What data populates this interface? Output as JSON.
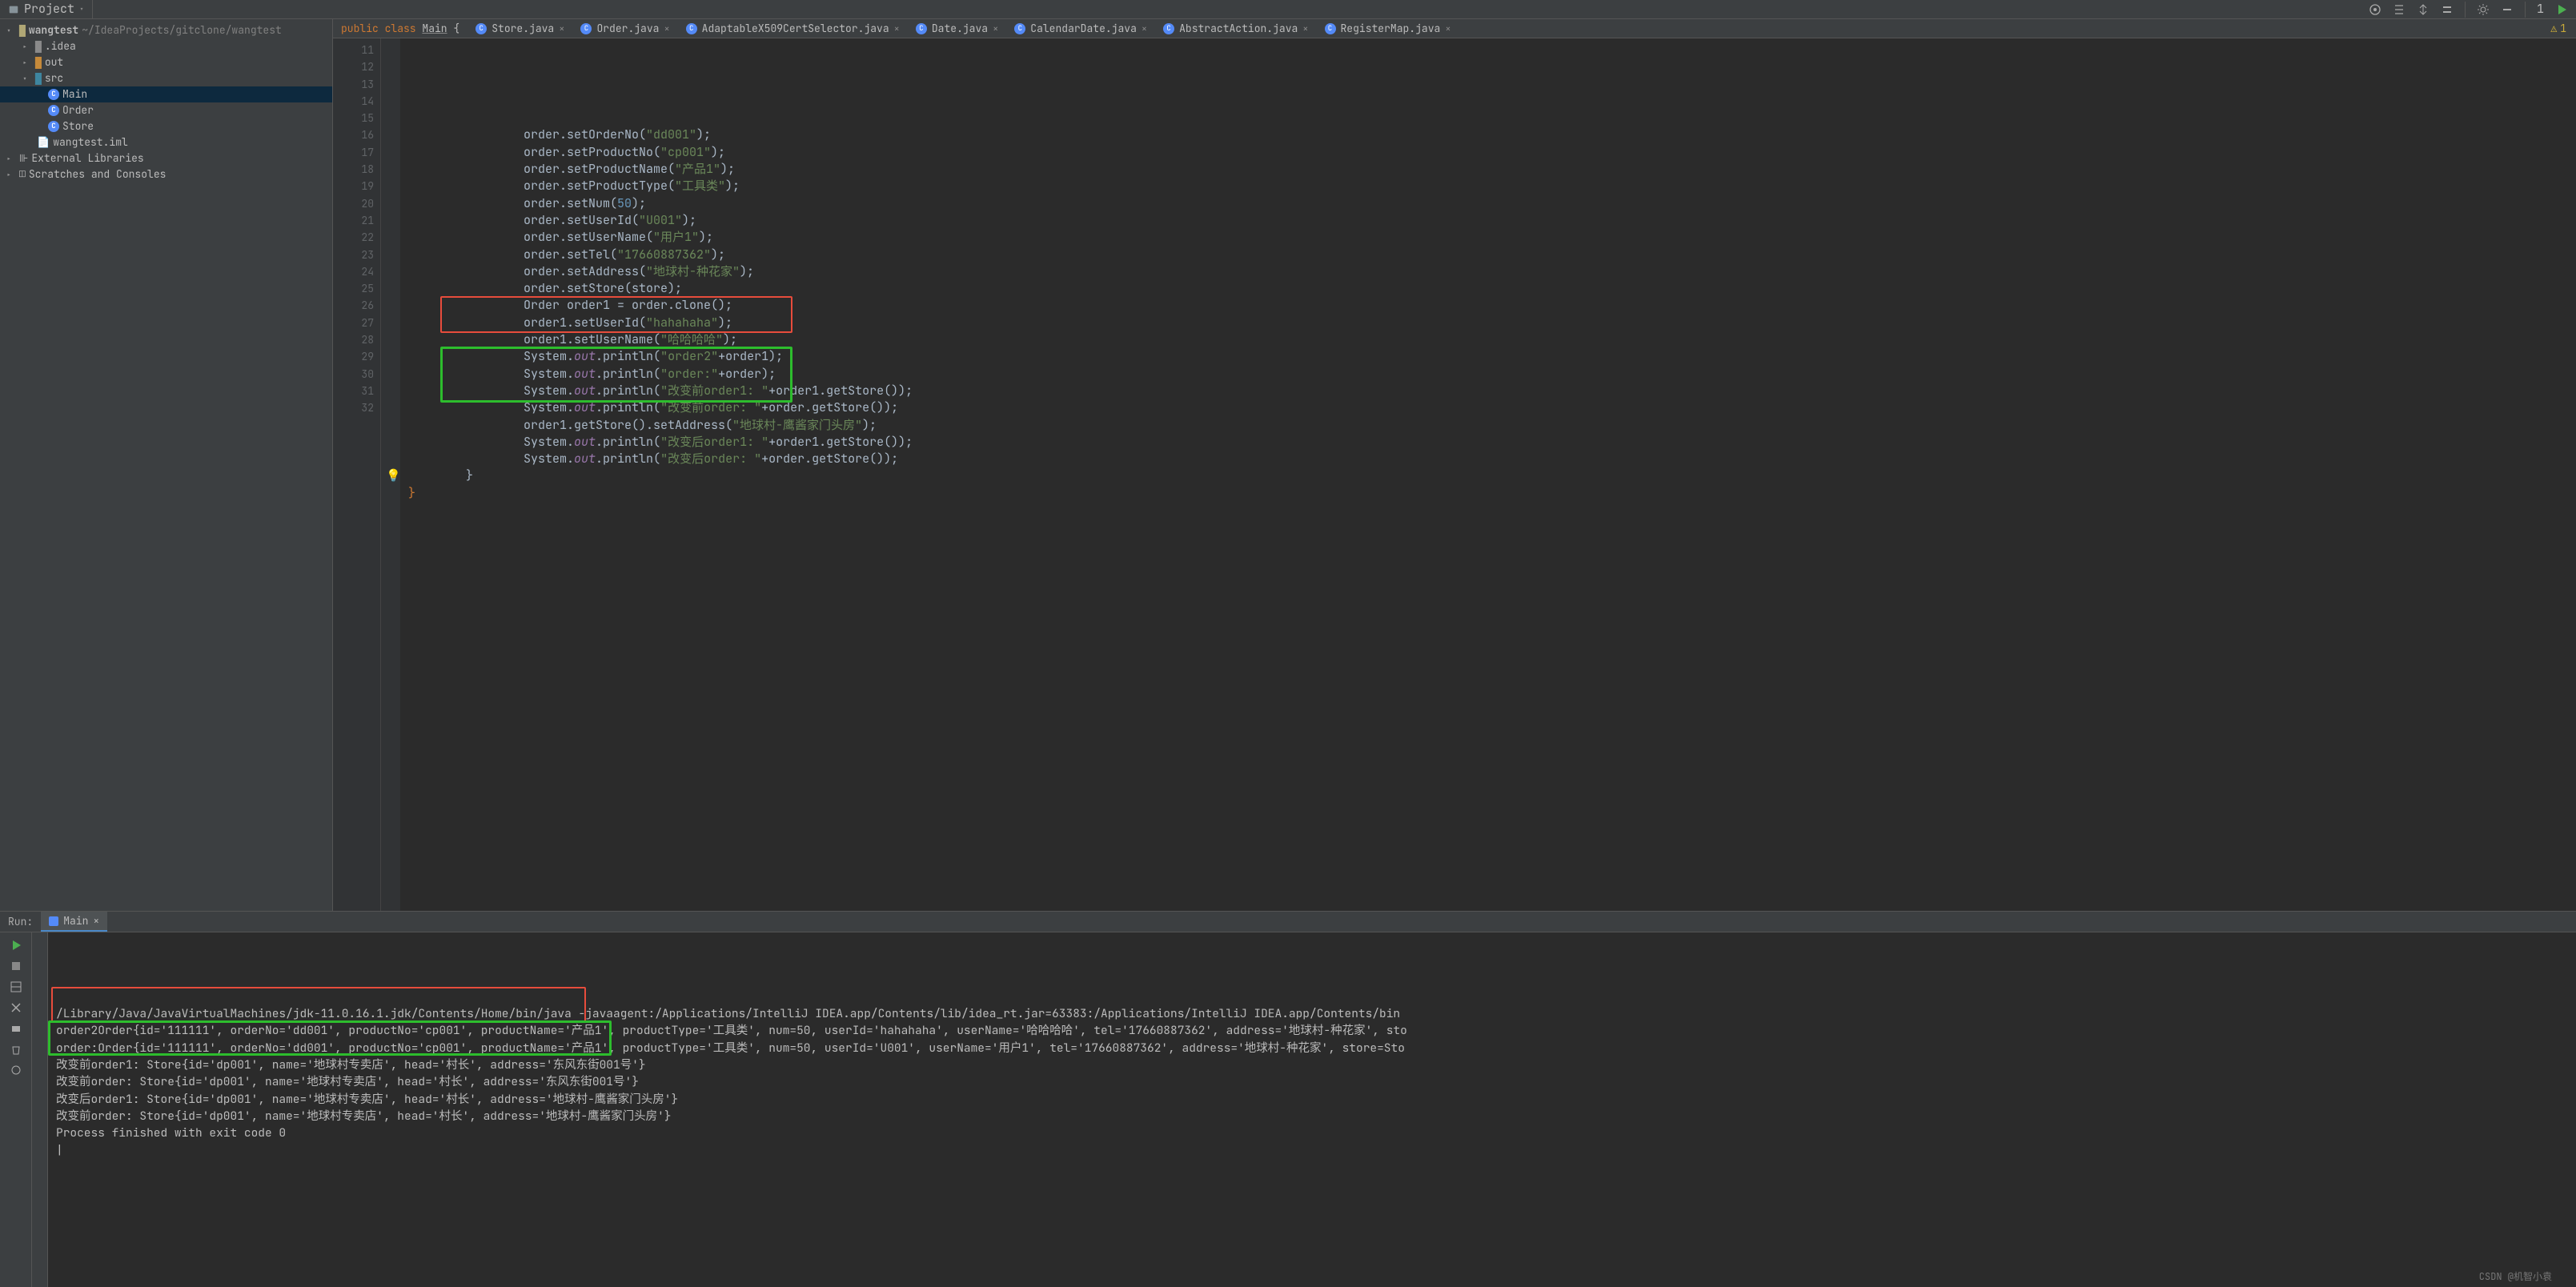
{
  "toolbar": {
    "project_label": "Project"
  },
  "run_config": {
    "label": "1"
  },
  "breadcrumb": {
    "pref": "public class ",
    "name": "Main",
    "brace": " {"
  },
  "tabs": [
    {
      "label": "Store.java"
    },
    {
      "label": "Order.java"
    },
    {
      "label": "AdaptableX509CertSelector.java"
    },
    {
      "label": "Date.java"
    },
    {
      "label": "CalendarDate.java"
    },
    {
      "label": "AbstractAction.java"
    },
    {
      "label": "RegisterMap.java"
    }
  ],
  "problems": {
    "count": "1"
  },
  "tree": {
    "root": {
      "name": "wangtest",
      "path": "~/IdeaProjects/gitclone/wangtest"
    },
    "idea": ".idea",
    "out": "out",
    "src": "src",
    "main": "Main",
    "order": "Order",
    "store": "Store",
    "iml": "wangtest.iml",
    "ext": "External Libraries",
    "scratch": "Scratches and Consoles"
  },
  "gutter_lines": [
    "11",
    "12",
    "13",
    "14",
    "15",
    "16",
    "17",
    "18",
    "19",
    "20",
    "21",
    "22",
    "23",
    "24",
    "25",
    "26",
    "27",
    "28",
    "29",
    "30",
    "31",
    "32"
  ],
  "code_lines": [
    {
      "ind": 4,
      "p": [
        {
          "c": "txt",
          "t": "order.setOrderNo("
        },
        {
          "c": "str",
          "t": "\"dd001\""
        },
        {
          "c": "txt",
          "t": ");"
        }
      ]
    },
    {
      "ind": 4,
      "p": [
        {
          "c": "txt",
          "t": "order.setProductNo("
        },
        {
          "c": "str",
          "t": "\"cp001\""
        },
        {
          "c": "txt",
          "t": ");"
        }
      ]
    },
    {
      "ind": 4,
      "p": [
        {
          "c": "txt",
          "t": "order.setProductName("
        },
        {
          "c": "str",
          "t": "\"产品1\""
        },
        {
          "c": "txt",
          "t": ");"
        }
      ]
    },
    {
      "ind": 4,
      "p": [
        {
          "c": "txt",
          "t": "order.setProductType("
        },
        {
          "c": "str",
          "t": "\"工具类\""
        },
        {
          "c": "txt",
          "t": ");"
        }
      ]
    },
    {
      "ind": 4,
      "p": [
        {
          "c": "txt",
          "t": "order.setNum("
        },
        {
          "c": "num",
          "t": "50"
        },
        {
          "c": "txt",
          "t": ");"
        }
      ]
    },
    {
      "ind": 4,
      "p": [
        {
          "c": "txt",
          "t": "order.setUserId("
        },
        {
          "c": "str",
          "t": "\"U001\""
        },
        {
          "c": "txt",
          "t": ");"
        }
      ]
    },
    {
      "ind": 4,
      "p": [
        {
          "c": "txt",
          "t": "order.setUserName("
        },
        {
          "c": "str",
          "t": "\"用户1\""
        },
        {
          "c": "txt",
          "t": ");"
        }
      ]
    },
    {
      "ind": 4,
      "p": [
        {
          "c": "txt",
          "t": "order.setTel("
        },
        {
          "c": "str",
          "t": "\"17660887362\""
        },
        {
          "c": "txt",
          "t": ");"
        }
      ]
    },
    {
      "ind": 4,
      "p": [
        {
          "c": "txt",
          "t": "order.setAddress("
        },
        {
          "c": "str",
          "t": "\"地球村-种花家\""
        },
        {
          "c": "txt",
          "t": ");"
        }
      ]
    },
    {
      "ind": 4,
      "p": [
        {
          "c": "txt",
          "t": "order.setStore(store);"
        }
      ]
    },
    {
      "ind": 4,
      "p": [
        {
          "c": "txt",
          "t": "Order order1 = order.clone();"
        }
      ]
    },
    {
      "ind": 4,
      "p": [
        {
          "c": "txt",
          "t": "order1.setUserId("
        },
        {
          "c": "str",
          "t": "\"hahahaha\""
        },
        {
          "c": "txt",
          "t": ");"
        }
      ]
    },
    {
      "ind": 4,
      "p": [
        {
          "c": "txt",
          "t": "order1.setUserName("
        },
        {
          "c": "str",
          "t": "\"哈哈哈哈\""
        },
        {
          "c": "txt",
          "t": ");"
        }
      ]
    },
    {
      "ind": 4,
      "p": [
        {
          "c": "txt",
          "t": "System."
        },
        {
          "c": "fld",
          "t": "out"
        },
        {
          "c": "txt",
          "t": ".println("
        },
        {
          "c": "str",
          "t": "\"order2\""
        },
        {
          "c": "txt",
          "t": "+order1);"
        }
      ]
    },
    {
      "ind": 4,
      "p": [
        {
          "c": "txt",
          "t": "System."
        },
        {
          "c": "fld",
          "t": "out"
        },
        {
          "c": "txt",
          "t": ".println("
        },
        {
          "c": "str",
          "t": "\"order:\""
        },
        {
          "c": "txt",
          "t": "+order);"
        }
      ]
    },
    {
      "ind": 4,
      "p": [
        {
          "c": "txt",
          "t": "System."
        },
        {
          "c": "fld",
          "t": "out"
        },
        {
          "c": "txt",
          "t": ".println("
        },
        {
          "c": "str",
          "t": "\"改变前order1: \""
        },
        {
          "c": "txt",
          "t": "+order1.getStore());"
        }
      ]
    },
    {
      "ind": 4,
      "p": [
        {
          "c": "txt",
          "t": "System."
        },
        {
          "c": "fld",
          "t": "out"
        },
        {
          "c": "txt",
          "t": ".println("
        },
        {
          "c": "str",
          "t": "\"改变前order: \""
        },
        {
          "c": "txt",
          "t": "+order.getStore());"
        }
      ]
    },
    {
      "ind": 4,
      "p": [
        {
          "c": "txt",
          "t": "order1.getStore().setAddress("
        },
        {
          "c": "str",
          "t": "\"地球村-鹰酱家门头房\""
        },
        {
          "c": "txt",
          "t": ");"
        }
      ]
    },
    {
      "ind": 4,
      "p": [
        {
          "c": "txt",
          "t": "System."
        },
        {
          "c": "fld",
          "t": "out"
        },
        {
          "c": "txt",
          "t": ".println("
        },
        {
          "c": "str",
          "t": "\"改变后order1: \""
        },
        {
          "c": "txt",
          "t": "+order1.getStore());"
        }
      ]
    },
    {
      "ind": 4,
      "p": [
        {
          "c": "txt",
          "t": "System."
        },
        {
          "c": "fld",
          "t": "out"
        },
        {
          "c": "txt",
          "t": ".println("
        },
        {
          "c": "str",
          "t": "\"改变后order: \""
        },
        {
          "c": "txt",
          "t": "+order.getStore());"
        }
      ]
    },
    {
      "ind": 2,
      "p": [
        {
          "c": "txt",
          "t": "}"
        }
      ]
    },
    {
      "ind": 0,
      "p": [
        {
          "c": "kw",
          "t": "}"
        }
      ]
    }
  ],
  "run": {
    "label": "Run:",
    "tab": "Main",
    "lines": [
      "/Library/Java/JavaVirtualMachines/jdk-11.0.16.1.jdk/Contents/Home/bin/java -javaagent:/Applications/IntelliJ IDEA.app/Contents/lib/idea_rt.jar=63383:/Applications/IntelliJ IDEA.app/Contents/bin",
      "order2Order{id='111111', orderNo='dd001', productNo='cp001', productName='产品1', productType='工具类', num=50, userId='hahahaha', userName='哈哈哈哈', tel='17660887362', address='地球村-种花家', sto",
      "order:Order{id='111111', orderNo='dd001', productNo='cp001', productName='产品1', productType='工具类', num=50, userId='U001', userName='用户1', tel='17660887362', address='地球村-种花家', store=Sto",
      "改变前order1: Store{id='dp001', name='地球村专卖店', head='村长', address='东风东街001号'}",
      "改变前order: Store{id='dp001', name='地球村专卖店', head='村长', address='东风东街001号'}",
      "改变后order1: Store{id='dp001', name='地球村专卖店', head='村长', address='地球村-鹰酱家门头房'}",
      "改变前order: Store{id='dp001', name='地球村专卖店', head='村长', address='地球村-鹰酱家门头房'}",
      "",
      "Process finished with exit code 0",
      "|"
    ]
  },
  "watermark": "CSDN @机智小袁"
}
